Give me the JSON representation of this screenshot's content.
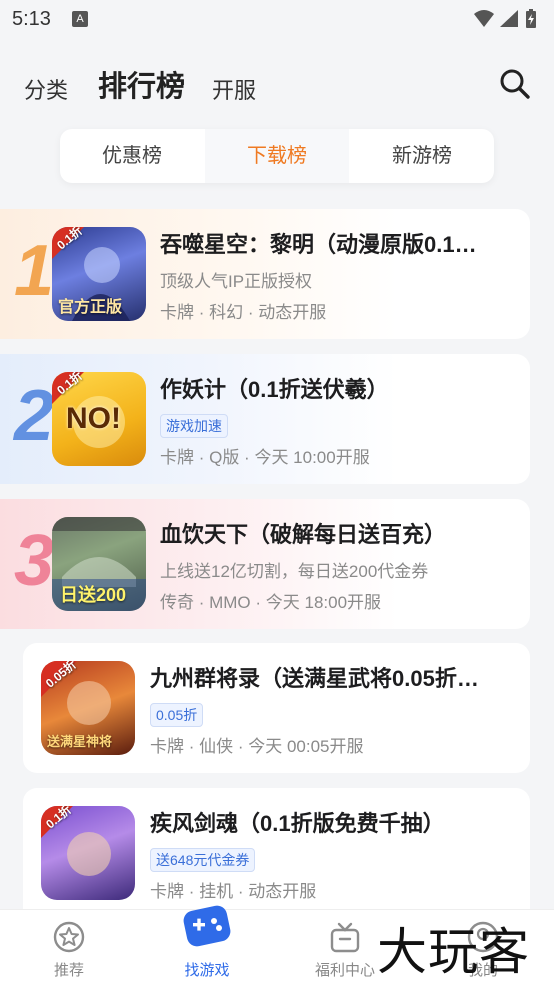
{
  "status": {
    "time": "5:13",
    "notification_glyph": "A"
  },
  "header": {
    "tab_category": "分类",
    "tab_ranking": "排行榜",
    "tab_open": "开服"
  },
  "segments": [
    {
      "label": "优惠榜",
      "active": false
    },
    {
      "label": "下载榜",
      "active": true
    },
    {
      "label": "新游榜",
      "active": false
    }
  ],
  "games": [
    {
      "rank": "1",
      "title": "吞噬星空：黎明（动漫原版0.1…",
      "subtitle": "顶级人气IP正版授权",
      "badge": "",
      "tags": "卡牌 · 科幻 · 动态开服",
      "icon_text": "官方正版",
      "icon_corner": "0.1折"
    },
    {
      "rank": "2",
      "title": "作妖计（0.1折送伏羲）",
      "subtitle": "",
      "badge": "游戏加速",
      "tags": "卡牌 · Q版 · 今天 10:00开服",
      "icon_text": "NO!",
      "icon_corner": "0.1折"
    },
    {
      "rank": "3",
      "title": "血饮天下（破解每日送百充）",
      "subtitle": "上线送12亿切割，每日送200代金券",
      "badge": "",
      "tags": "传奇 · MMO · 今天 18:00开服",
      "icon_text": "日送200",
      "icon_corner": ""
    },
    {
      "rank": "",
      "title": "九州群将录（送满星武将0.05折…",
      "subtitle": "",
      "badge": "0.05折",
      "tags": "卡牌 · 仙侠 · 今天 00:05开服",
      "icon_text": "送满星神将",
      "icon_corner": "0.05折"
    },
    {
      "rank": "",
      "title": "疾风剑魂（0.1折版免费千抽）",
      "subtitle": "",
      "badge": "送648元代金券",
      "tags": "卡牌 · 挂机 · 动态开服",
      "icon_text": "",
      "icon_corner": "0.1折"
    }
  ],
  "tabbar": [
    {
      "label": "推荐",
      "icon": "star-circle-icon",
      "active": false
    },
    {
      "label": "找游戏",
      "icon": "gamepad-icon",
      "active": true
    },
    {
      "label": "福利中心",
      "icon": "gift-box-icon",
      "active": false
    },
    {
      "label": "我的",
      "icon": "profile-icon",
      "active": false
    }
  ],
  "watermark": "大玩客",
  "colors": {
    "accent_orange": "#ef7a22",
    "accent_blue": "#2f6be8",
    "badge_blue": "#3a6fd8"
  }
}
